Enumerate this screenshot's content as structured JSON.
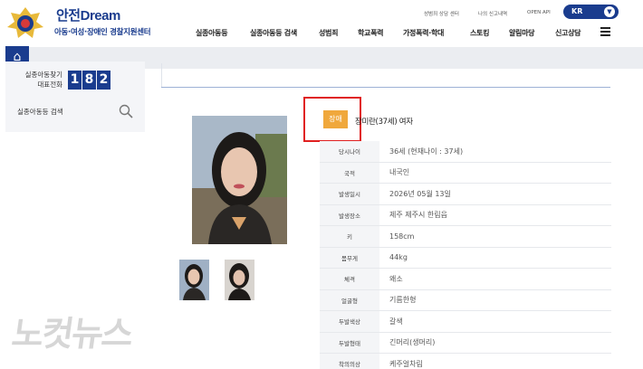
{
  "header": {
    "brand_title": "안전",
    "brand_title_en": "Dream",
    "brand_sub": "아동·여성·장애인 경찰지원센터",
    "util_links": [
      "성범죄 상담 센터",
      "나의 신고내역",
      "OPEN API"
    ],
    "lang": "KR",
    "nav": [
      "실종아동등",
      "실종아동등 검색",
      "성범죄",
      "학교폭력",
      "가정폭력·학대",
      "스토킹",
      "알림마당",
      "신고상담"
    ],
    "home_icon": "home-icon",
    "menu_icon": "hamburger-icon"
  },
  "side": {
    "hotline_label_1": "실종아동찾기",
    "hotline_label_2": "대표전화",
    "hotline_digits": [
      "1",
      "8",
      "2"
    ],
    "search_label": "실종아동등 검색",
    "search_icon": "search-icon"
  },
  "profile": {
    "badge": "장애",
    "name": "장미란(37세) 여자",
    "rows": [
      {
        "label": "당시나이",
        "value": "36세 (현재나이 : 37세)"
      },
      {
        "label": "국적",
        "value": "내국인"
      },
      {
        "label": "발생일시",
        "value": "2026년 05월 13일"
      },
      {
        "label": "발생장소",
        "value": "제주 제주시 한림읍"
      },
      {
        "label": "키",
        "value": "158cm"
      },
      {
        "label": "몸무게",
        "value": "44kg"
      },
      {
        "label": "체격",
        "value": "왜소"
      },
      {
        "label": "얼굴형",
        "value": "기름한형"
      },
      {
        "label": "두발색상",
        "value": "갈색"
      },
      {
        "label": "두발형태",
        "value": "긴머리(생머리)"
      },
      {
        "label": "착의의상",
        "value": "케주얼차림"
      }
    ]
  },
  "watermark": "노컷뉴스",
  "colors": {
    "brand": "#1a3c8e",
    "badge": "#f0a83c",
    "highlight": "#e02020"
  }
}
